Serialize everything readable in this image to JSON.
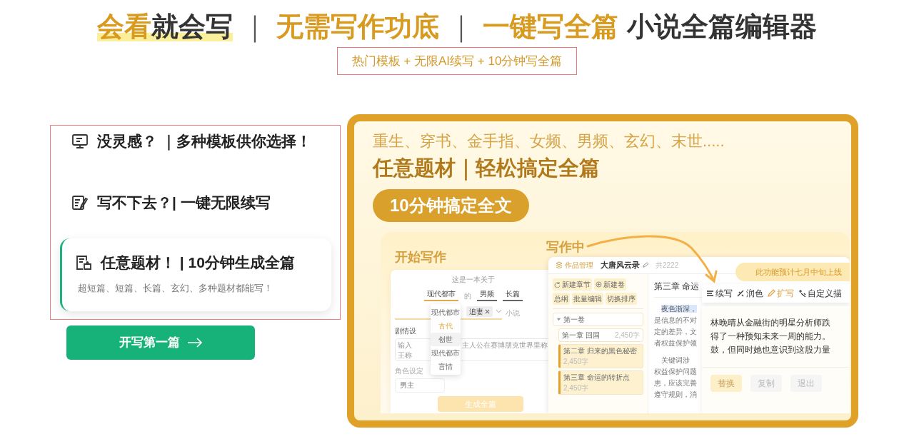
{
  "headline": [
    {
      "text": "会看",
      "kind": "text",
      "accent": true,
      "marked": true
    },
    {
      "text": "就会写",
      "kind": "text",
      "accent": false,
      "marked": true
    },
    {
      "text": "｜",
      "kind": "separator"
    },
    {
      "text": "无需写作功底",
      "kind": "text",
      "accent": true,
      "marked": false
    },
    {
      "text": "｜",
      "kind": "separator"
    },
    {
      "text": "一键写全篇",
      "kind": "text",
      "accent": true,
      "marked": false
    },
    {
      "text": "小说全篇编辑器",
      "kind": "text",
      "accent": false,
      "marked": false
    }
  ],
  "subtitle": "热门模板 + 无限AI续写 + 10分钟写全篇",
  "features": [
    {
      "title": "没灵感？ ｜多种模板供你选择！",
      "selected": false
    },
    {
      "title": "写不下去？| 一键无限续写",
      "selected": false
    },
    {
      "title": "任意题材！ | 10分钟生成全篇",
      "description": "超短篇、短篇、长篇、玄幻、多种题材都能写！",
      "selected": true
    }
  ],
  "start_button": "开写第一篇",
  "showcase": {
    "genres": "重生、穿书、金手指、女频、男频、玄幻、末世.....",
    "heading": "任意题材｜轻松搞定全篇",
    "pill": "10分钟搞定全文",
    "start_label": "开始写作",
    "writing_label": "写作中",
    "form": {
      "intro": "这是一本关于",
      "joiner": "的",
      "selects": [
        {
          "value": "现代都市",
          "open": true
        },
        {
          "value": "男频",
          "open": false
        },
        {
          "value": "长篇",
          "open": false
        }
      ],
      "dropdown": [
        {
          "label": "现代都市",
          "selected": false,
          "hovered": false
        },
        {
          "label": "古代",
          "selected": true,
          "hovered": false
        },
        {
          "label": "创世",
          "selected": false,
          "hovered": true
        },
        {
          "label": "现代都市",
          "selected": false,
          "hovered": false
        },
        {
          "label": "言情",
          "selected": false,
          "hovered": false
        }
      ],
      "tags": [
        "追妻"
      ],
      "tags_suffix": "小说",
      "plot_label": "剧情设",
      "plot_text": [
        "输入",
        "主人公在赛博朋克世界里称",
        "王称"
      ],
      "role_label": "角色设定",
      "role_placeholder": "男主",
      "generate_button": "生成全篇"
    },
    "window": {
      "section": "作品管理",
      "book_title": "大唐风云录",
      "word_total": "共2222",
      "actions": [
        "新建章节",
        "新建卷",
        "总纲",
        "批量编辑",
        "切换排序"
      ],
      "volumes": [
        {
          "label": "第一卷",
          "expanded": true,
          "children": [
            {
              "label": "第一章 回国",
              "count": "2,450字",
              "selected": false
            },
            {
              "label": "第二章 归来的黑色秘密",
              "count": "2,450字",
              "selected": true
            },
            {
              "label": "第三章 命运的转折点",
              "count": "2,450字",
              "selected": true
            }
          ]
        }
      ],
      "chapter_title": "第三章 命运",
      "paragraphs": [
        {
          "selection": "夜色渐深，",
          "lines": [
            "是信息的不对",
            "定的差异，文",
            "者权益保护领"
          ]
        },
        {
          "lines": [
            "关键词涉",
            "权益保护问题",
            "患，应该完善",
            "遵守规则，消"
          ]
        }
      ]
    },
    "notice": "此功能预计七月中旬上线",
    "ai_popup": {
      "tools": [
        {
          "label": "续写",
          "selected": false
        },
        {
          "label": "润色",
          "selected": false
        },
        {
          "label": "扩写",
          "selected": true
        },
        {
          "label": "自定义描",
          "selected": false
        }
      ],
      "lines": [
        "林晚晴从金融街的明星分析师跌",
        "得了一种预知未来一周的能力。",
        "鼓，但同时她也意识到这股力量"
      ],
      "actions": [
        {
          "label": "替换",
          "primary": true
        },
        {
          "label": "复制",
          "primary": false
        },
        {
          "label": "退出",
          "primary": false
        }
      ]
    }
  }
}
